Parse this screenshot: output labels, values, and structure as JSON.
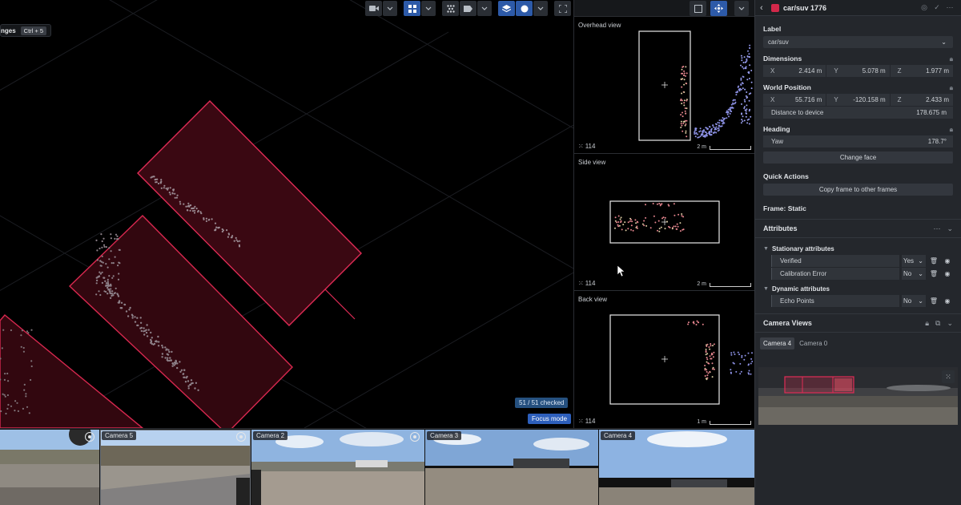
{
  "viewport": {
    "shortcut_label": "nges",
    "shortcut_key": "Ctrl + 5",
    "checked_badge": "51 / 51 checked",
    "focus_mode": "Focus mode",
    "toolbar_icons": [
      "video-camera-icon",
      "layout-grid-icon",
      "grid-dots-icon",
      "tag-icon",
      "layers-icon",
      "circle-icon",
      "fullscreen-icon"
    ]
  },
  "views": {
    "toolbar_icons": [
      "box-select-icon",
      "move-arrows-icon",
      "chevron-down-icon"
    ],
    "overhead": {
      "title": "Overhead view",
      "count": "114",
      "scale": "2 m"
    },
    "side": {
      "title": "Side view",
      "count": "114",
      "scale": "2 m"
    },
    "back": {
      "title": "Back view",
      "count": "114",
      "scale": "1 m"
    }
  },
  "panel": {
    "title": "car/suv 1776",
    "label_section": "Label",
    "label_value": "car/suv",
    "dimensions": {
      "label": "Dimensions",
      "x": "2.414 m",
      "y": "5.078 m",
      "z": "1.977 m"
    },
    "world_position": {
      "label": "World Position",
      "x": "55.716 m",
      "y": "-120.158 m",
      "z": "2.433 m",
      "distance_label": "Distance to device",
      "distance_value": "178.675 m"
    },
    "heading": {
      "label": "Heading",
      "yaw_label": "Yaw",
      "yaw_value": "178.7°",
      "change_face": "Change face"
    },
    "quick_actions": {
      "label": "Quick Actions",
      "copy_frame": "Copy frame to other frames"
    },
    "frame_status": "Frame: Static",
    "attributes": {
      "title": "Attributes",
      "stationary_title": "Stationary attributes",
      "stationary": [
        {
          "name": "Verified",
          "value": "Yes"
        },
        {
          "name": "Calibration Error",
          "value": "No"
        }
      ],
      "dynamic_title": "Dynamic attributes",
      "dynamic": [
        {
          "name": "Echo Points",
          "value": "No"
        }
      ]
    },
    "camera_views": {
      "title": "Camera Views",
      "tabs": [
        "Camera 4",
        "Camera 0"
      ]
    },
    "accent_color": "#d2284a"
  },
  "cameras": [
    {
      "label": ""
    },
    {
      "label": "Camera 5"
    },
    {
      "label": "Camera 2"
    },
    {
      "label": "Camera 3"
    },
    {
      "label": "Camera 4"
    }
  ]
}
